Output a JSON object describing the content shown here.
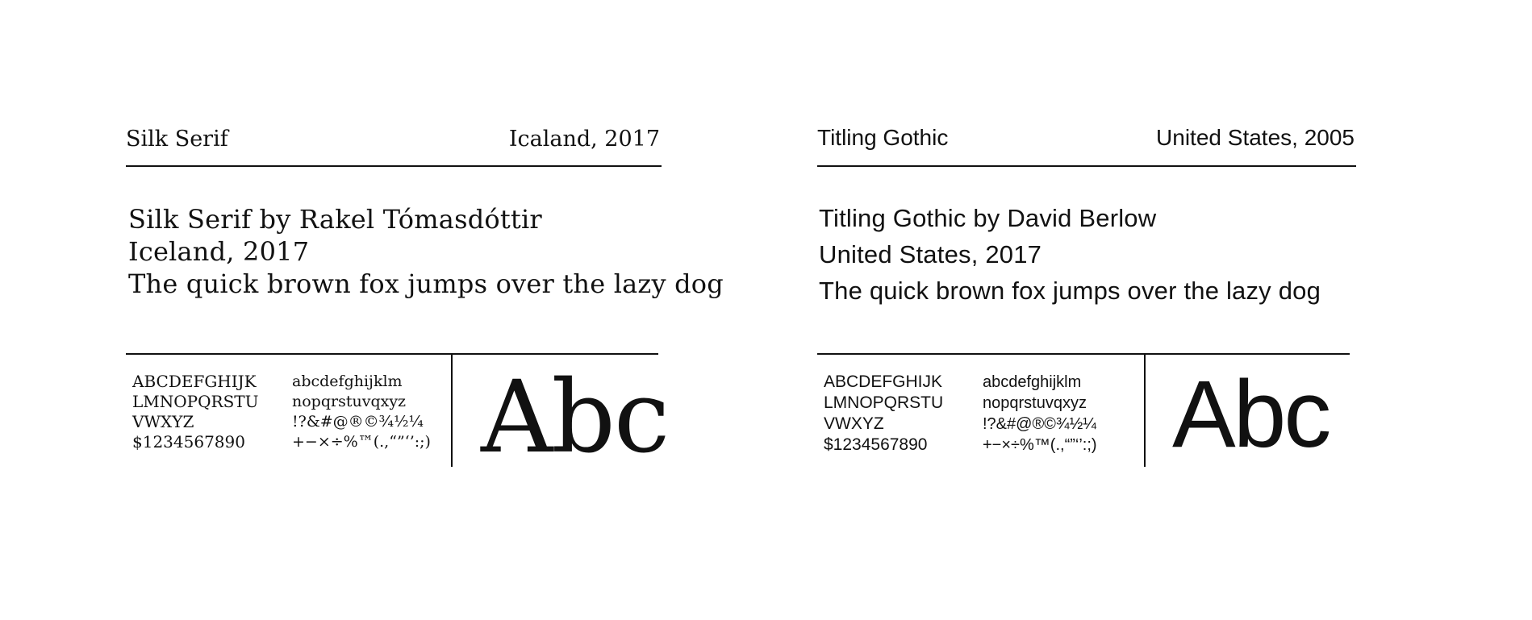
{
  "specimens": [
    {
      "name": "Silk Serif",
      "origin": "Icaland, 2017",
      "sample_lines": [
        "Silk Serif by Rakel Tómasdóttir",
        "Iceland, 2017",
        "The quick brown fox jumps over the lazy dog"
      ],
      "glyph_col1": [
        "ABCDEFGHIJK",
        "LMNOPQRSTU",
        "VWXYZ",
        "$1234567890"
      ],
      "glyph_col2": [
        "abcdefghijklm",
        "nopqrstuvqxyz",
        "!?&#@®©¾½¼",
        "+−×÷%™(.,“”‘’:;)"
      ],
      "display": "Abc"
    },
    {
      "name": "Titling Gothic",
      "origin": "United States, 2005",
      "sample_lines": [
        "Titling Gothic by David Berlow",
        "United States, 2017",
        "The quick brown fox jumps over the lazy dog"
      ],
      "glyph_col1": [
        "ABCDEFGHIJK",
        "LMNOPQRSTU",
        "VWXYZ",
        "$1234567890"
      ],
      "glyph_col2": [
        "abcdefghijklm",
        "nopqrstuvqxyz",
        "!?&#@®©¾½¼",
        "+−×÷%™(.,“”‘’:;)"
      ],
      "display": "Abc"
    }
  ]
}
